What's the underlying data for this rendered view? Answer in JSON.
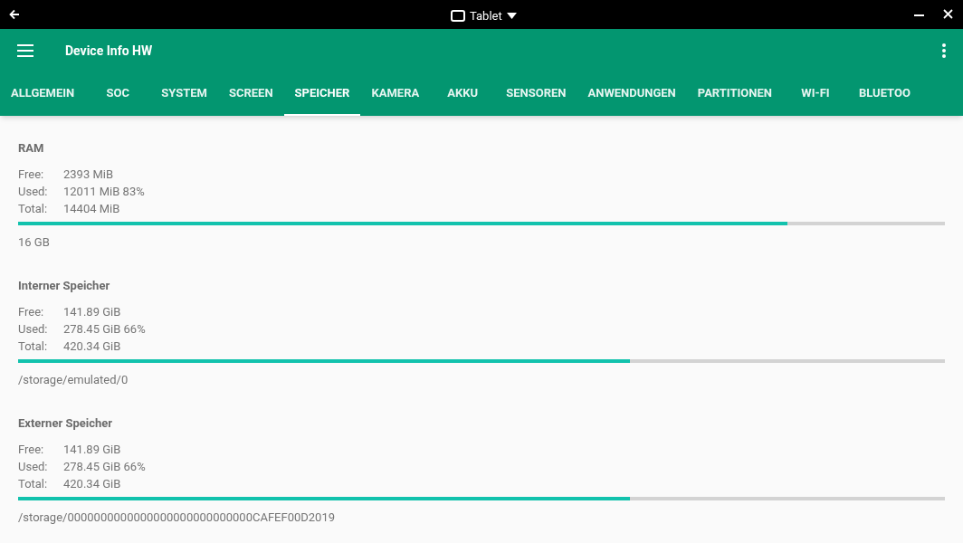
{
  "window": {
    "title": "Tablet"
  },
  "app_bar": {
    "title": "Device Info HW"
  },
  "tabs": [
    {
      "label": "ALLGEMEIN",
      "selected": false
    },
    {
      "label": "SOC",
      "selected": false
    },
    {
      "label": "SYSTEM",
      "selected": false
    },
    {
      "label": "SCREEN",
      "selected": false
    },
    {
      "label": "SPEICHER",
      "selected": true
    },
    {
      "label": "KAMERA",
      "selected": false
    },
    {
      "label": "AKKU",
      "selected": false
    },
    {
      "label": "SENSOREN",
      "selected": false
    },
    {
      "label": "ANWENDUNGEN",
      "selected": false
    },
    {
      "label": "PARTITIONEN",
      "selected": false
    },
    {
      "label": "WI-FI",
      "selected": false
    },
    {
      "label": "BLUETOO",
      "selected": false
    }
  ],
  "sections": [
    {
      "title": "RAM",
      "rows": [
        {
          "label": "Free:",
          "value": "2393 MiB"
        },
        {
          "label": "Used:",
          "value": "12011 MiB 83%"
        },
        {
          "label": "Total:",
          "value": "14404 MiB"
        }
      ],
      "level": 0.83,
      "footer": "16 GB"
    },
    {
      "title": "Interner Speicher",
      "rows": [
        {
          "label": "Free:",
          "value": "141.89 GiB"
        },
        {
          "label": "Used:",
          "value": "278.45 GiB 66%"
        },
        {
          "label": "Total:",
          "value": "420.34 GiB"
        }
      ],
      "level": 0.66,
      "footer": "/storage/emulated/0"
    },
    {
      "title": "Externer Speicher",
      "rows": [
        {
          "label": "Free:",
          "value": "141.89 GiB"
        },
        {
          "label": "Used:",
          "value": "278.45 GiB 66%"
        },
        {
          "label": "Total:",
          "value": "420.34 GiB"
        }
      ],
      "level": 0.66,
      "footer": "/storage/0000000000000000000000000000CAFEF00D2019"
    }
  ]
}
